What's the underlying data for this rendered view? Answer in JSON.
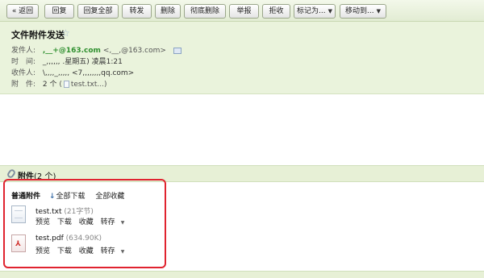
{
  "toolbar": {
    "back": "« 返回",
    "reply": "回复",
    "reply_all": "回复全部",
    "forward": "转发",
    "delete": "删除",
    "delete_permanent": "彻底删除",
    "report": "举报",
    "reject": "拒收",
    "mark_as": "标记为...",
    "move_to": "移动到...",
    "dropdown_icon": "triangle-down"
  },
  "mail": {
    "subject": "文件附件发送",
    "star_icon": "star-outline",
    "from_label": "发件人:",
    "from_name": ",__+@163.com",
    "from_address": "<,__,@163.com>",
    "time_label": "时　间:",
    "time_value": "_,,,,,, .星期五) 凌晨1:21",
    "to_label": "收件人:",
    "to_value": "\\,,,,_,,,,, <7,,,,,,,,qq.com>",
    "attach_label": "附　件:",
    "attach_count": "2 个",
    "attach_preview": "test.txt...)"
  },
  "attachments": {
    "section_title": "附件",
    "section_count": "(2 个)",
    "normal_label": "普通附件",
    "download_all": "全部下载",
    "save_all": "全部收藏",
    "files": [
      {
        "name": "test.txt",
        "size": "(21字节)",
        "type_icon": "text-file-icon"
      },
      {
        "name": "test.pdf",
        "size": "(634.90K)",
        "type_icon": "pdf-file-icon"
      }
    ],
    "actions": {
      "preview": "预览",
      "download": "下载",
      "favorite": "收藏",
      "save_to": "转存"
    }
  },
  "colors": {
    "toolbar_bg": "#e2ecd3",
    "header_bg": "#eaf3dc",
    "sender_green": "#2e8f2e",
    "highlight_red": "#e0232f"
  }
}
